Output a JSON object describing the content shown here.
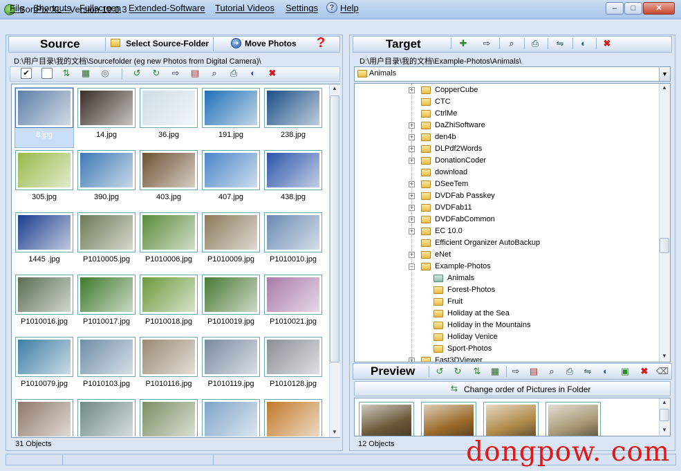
{
  "window": {
    "title": "SortPix XL - Version 19.0.3",
    "min": "‒",
    "max": "□",
    "close": "✕"
  },
  "menu": [
    "File",
    "Shortcuts",
    "Fullscreen",
    "Extended-Software",
    "Tutorial Videos",
    "Settings",
    "Help"
  ],
  "source": {
    "label": "Source",
    "select_button": "Select Source-Folder",
    "move_button": "Move Photos",
    "help_icon": "?",
    "path": "D:\\用户目录\\我的文档\\Sourcefolder (eg new Photos from Digital Camera)\\",
    "thumbs": [
      {
        "name": "8.jpg",
        "color": "#5d7fa8",
        "selected": true
      },
      {
        "name": "14.jpg",
        "color": "#3a2e25"
      },
      {
        "name": "36.jpg",
        "color": "#cfdde6"
      },
      {
        "name": "191.jpg",
        "color": "#1f6fb7"
      },
      {
        "name": "238.jpg",
        "color": "#1b4f86"
      },
      {
        "name": "305.jpg",
        "color": "#98b94a"
      },
      {
        "name": "390.jpg",
        "color": "#3d79b4"
      },
      {
        "name": "403.jpg",
        "color": "#6d5131"
      },
      {
        "name": "407.jpg",
        "color": "#4b86c7"
      },
      {
        "name": "438.jpg",
        "color": "#2a54a7"
      },
      {
        "name": "1445 .jpg",
        "color": "#1b3d8f"
      },
      {
        "name": "P1010005.jpg",
        "color": "#6b7a54"
      },
      {
        "name": "P1010006.jpg",
        "color": "#5b8c3a"
      },
      {
        "name": "P1010009.jpg",
        "color": "#8a7a5a"
      },
      {
        "name": "P1010010.jpg",
        "color": "#6a8ab2"
      },
      {
        "name": "P1010016.jpg",
        "color": "#5b6f54"
      },
      {
        "name": "P1010017.jpg",
        "color": "#3f7a2e"
      },
      {
        "name": "P1010018.jpg",
        "color": "#6c9a3c"
      },
      {
        "name": "P1010019.jpg",
        "color": "#4a7a35"
      },
      {
        "name": "P1010021.jpg",
        "color": "#a87aa8"
      },
      {
        "name": "P1010079.jpg",
        "color": "#3f7fa6"
      },
      {
        "name": "P1010103.jpg",
        "color": "#6f8fa8"
      },
      {
        "name": "P1010116.jpg",
        "color": "#9a8a72"
      },
      {
        "name": "P1010119.jpg",
        "color": "#7a8aa0"
      },
      {
        "name": "P1010128.jpg",
        "color": "#8a8f96"
      },
      {
        "name": "",
        "color": "#8f7a6a"
      },
      {
        "name": "",
        "color": "#6f8a86"
      },
      {
        "name": "",
        "color": "#7c8f63"
      },
      {
        "name": "",
        "color": "#7fa5c8"
      },
      {
        "name": "",
        "color": "#c27a2b"
      }
    ],
    "status": "31 Objects"
  },
  "target": {
    "label": "Target",
    "path": "D:\\用户目录\\我的文档\\Example-Photos\\Animals\\",
    "dropdown_value": "Animals",
    "tree": [
      {
        "label": "CopperCube",
        "level": 0,
        "exp": "+"
      },
      {
        "label": "CTC",
        "level": 0,
        "exp": ""
      },
      {
        "label": "CtrlMe",
        "level": 0,
        "exp": ""
      },
      {
        "label": "DaZhiSoftware",
        "level": 0,
        "exp": "+"
      },
      {
        "label": "den4b",
        "level": 0,
        "exp": "+"
      },
      {
        "label": "DLPdf2Words",
        "level": 0,
        "exp": "+"
      },
      {
        "label": "DonationCoder",
        "level": 0,
        "exp": "+"
      },
      {
        "label": "download",
        "level": 0,
        "exp": ""
      },
      {
        "label": "DSeeTem",
        "level": 0,
        "exp": "+"
      },
      {
        "label": "DVDFab Passkey",
        "level": 0,
        "exp": "+"
      },
      {
        "label": "DVDFab11",
        "level": 0,
        "exp": "+"
      },
      {
        "label": "DVDFabCommon",
        "level": 0,
        "exp": "+"
      },
      {
        "label": "EC 10.0",
        "level": 0,
        "exp": "+"
      },
      {
        "label": "Efficient Organizer AutoBackup",
        "level": 0,
        "exp": ""
      },
      {
        "label": "eNet",
        "level": 0,
        "exp": "+"
      },
      {
        "label": "Example-Photos",
        "level": 0,
        "exp": "−"
      },
      {
        "label": "Animals",
        "level": 1,
        "exp": "",
        "open": true
      },
      {
        "label": "Forest-Photos",
        "level": 1,
        "exp": ""
      },
      {
        "label": "Fruit",
        "level": 1,
        "exp": ""
      },
      {
        "label": "Holiday at the Sea",
        "level": 1,
        "exp": ""
      },
      {
        "label": "Holiday in the Mountains",
        "level": 1,
        "exp": ""
      },
      {
        "label": "Holiday Venice",
        "level": 1,
        "exp": ""
      },
      {
        "label": "Sport-Photos",
        "level": 1,
        "exp": ""
      },
      {
        "label": "Fast3DViewer",
        "level": 0,
        "exp": "+"
      }
    ]
  },
  "preview": {
    "label": "Preview",
    "change_order_button": "Change order of Pictures in Folder",
    "thumbs": [
      {
        "color": "#6a5a3a"
      },
      {
        "color": "#9a6a2a"
      },
      {
        "color": "#b08a4a"
      },
      {
        "color": "#a89a78"
      }
    ],
    "status": "12 Objects"
  },
  "watermark": "dongpow. com"
}
